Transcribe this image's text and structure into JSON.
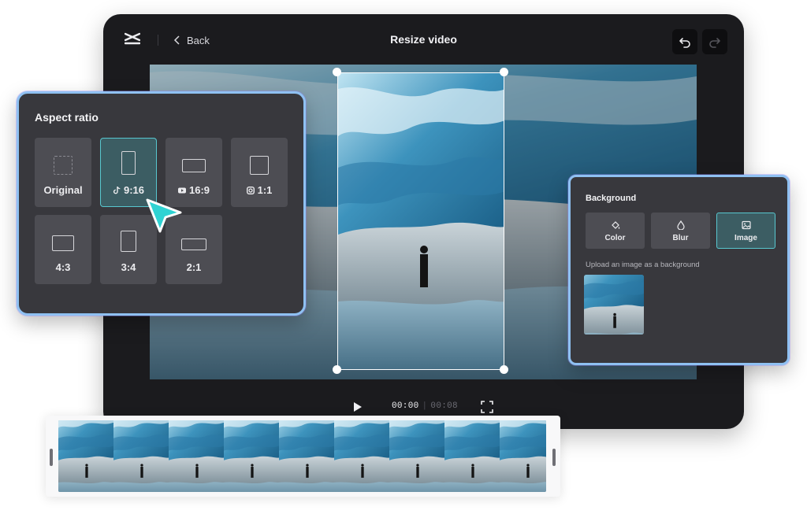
{
  "app": {
    "title": "Resize video",
    "back_label": "Back",
    "icons": {
      "logo": "capcut-logo-icon",
      "back": "chevron-left-icon",
      "undo": "undo-icon",
      "redo": "redo-icon"
    }
  },
  "player": {
    "current_time": "00:00",
    "separator": "|",
    "duration": "00:08",
    "icons": {
      "play": "play-icon",
      "fullscreen": "fullscreen-icon"
    }
  },
  "aspect_ratio": {
    "title": "Aspect ratio",
    "selected": "9:16",
    "options": [
      {
        "label": "Original",
        "icon": ""
      },
      {
        "label": "9:16",
        "icon": "tiktok-icon"
      },
      {
        "label": "16:9",
        "icon": "youtube-icon"
      },
      {
        "label": "1:1",
        "icon": "instagram-icon"
      },
      {
        "label": "4:3",
        "icon": ""
      },
      {
        "label": "3:4",
        "icon": ""
      },
      {
        "label": "2:1",
        "icon": ""
      }
    ]
  },
  "background": {
    "title": "Background",
    "selected": "Image",
    "options": [
      {
        "label": "Color",
        "icon": "paint-bucket-icon"
      },
      {
        "label": "Blur",
        "icon": "droplet-icon"
      },
      {
        "label": "Image",
        "icon": "image-icon"
      }
    ],
    "hint": "Upload an image as a background"
  },
  "colors": {
    "panel_border": "#8fc1f2",
    "selected_bg": "#3c5d63",
    "selected_border": "#58c7cf",
    "cursor": "#2fd3d3"
  }
}
